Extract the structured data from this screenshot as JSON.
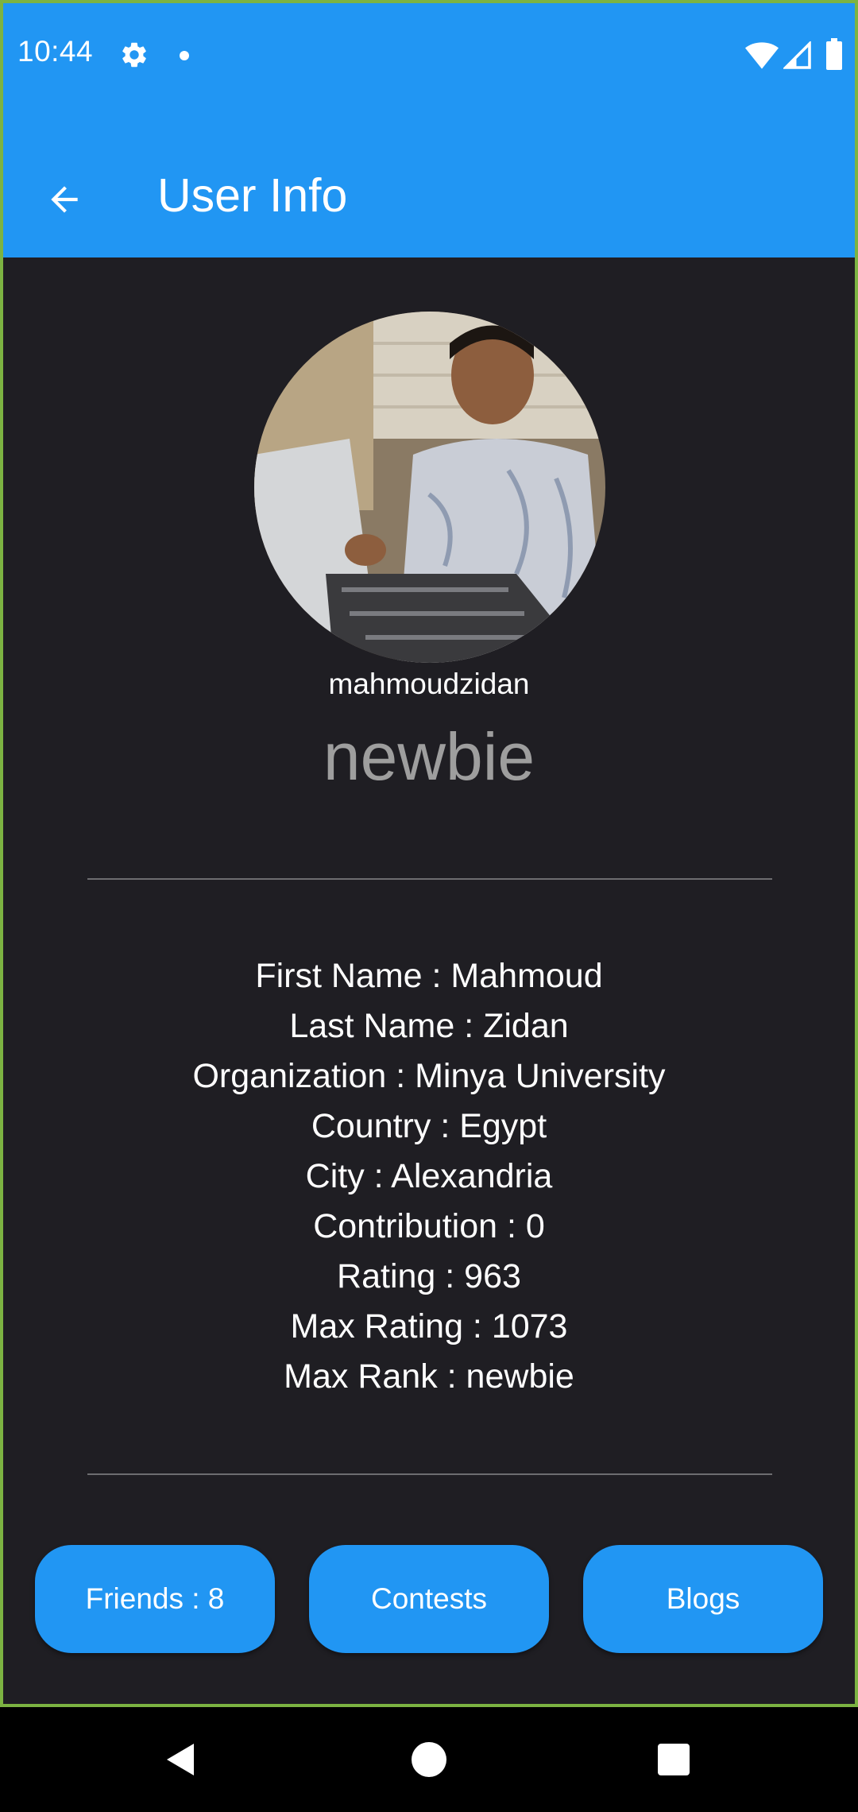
{
  "status_bar": {
    "time": "10:44",
    "icons": [
      "gear-icon",
      "notification-dot",
      "wifi-icon",
      "signal-icon",
      "battery-icon"
    ]
  },
  "app_bar": {
    "title": "User Info",
    "back_icon": "arrow-back-icon",
    "color": "#2196f3"
  },
  "profile": {
    "handle": "mahmoudzidan",
    "rank": "newbie"
  },
  "info": {
    "rows": [
      "First Name : Mahmoud",
      "Last Name : Zidan",
      "Organization : Minya University",
      "Country : Egypt",
      "City : Alexandria",
      "Contribution : 0",
      "Rating : 963",
      "Max Rating : 1073",
      "Max Rank : newbie"
    ]
  },
  "actions": {
    "friends": "Friends : 8",
    "contests": "Contests",
    "blogs": "Blogs"
  },
  "nav_bar": {
    "icons": [
      "nav-back-icon",
      "nav-home-icon",
      "nav-recents-icon"
    ]
  },
  "colors": {
    "background": "#1f1e23",
    "accent": "#2196f3",
    "rank_text": "#9e9e9e"
  }
}
